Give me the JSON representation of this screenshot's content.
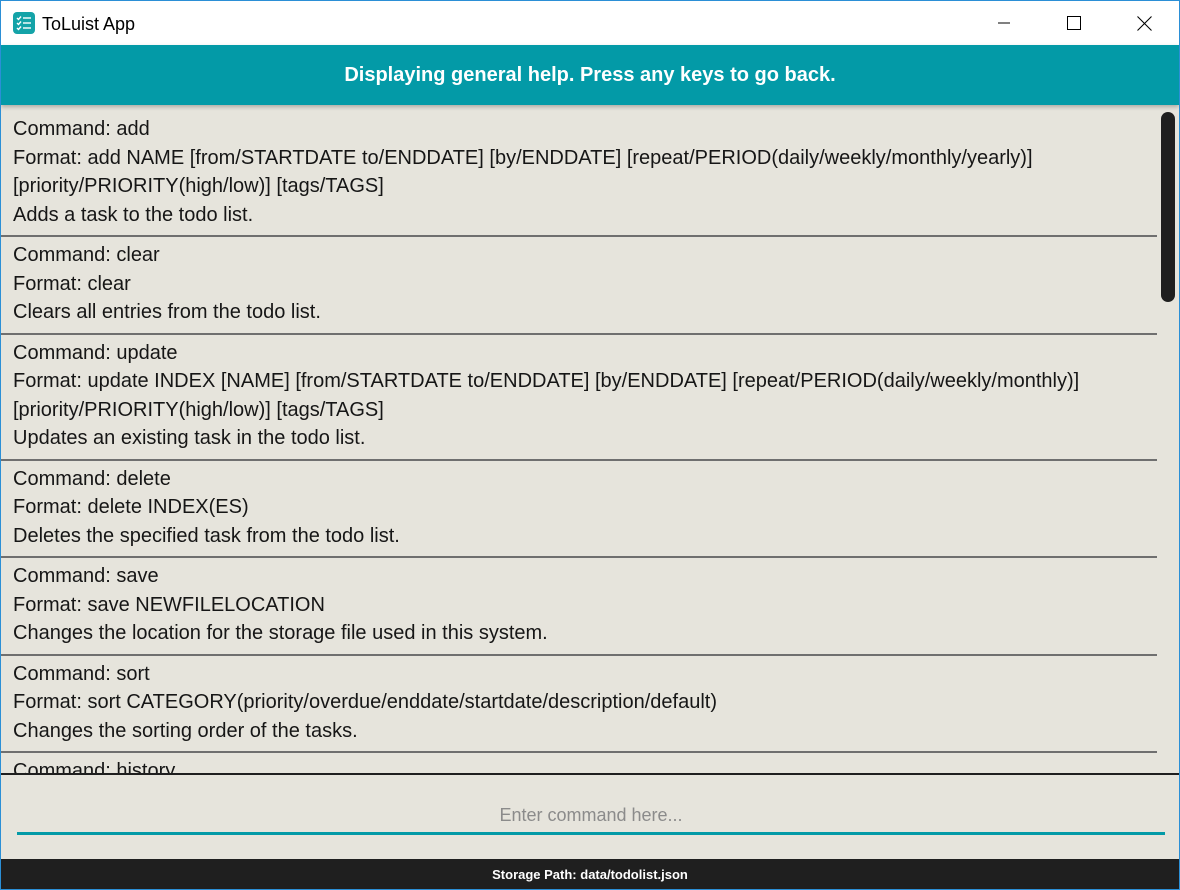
{
  "window": {
    "title": "ToLuist App",
    "app_icon": "checklist-icon",
    "controls": [
      "minimize-icon",
      "maximize-icon",
      "close-icon"
    ]
  },
  "banner": {
    "text": "Displaying general help. Press any keys to go back."
  },
  "commands": [
    {
      "command": "Command: add",
      "format": "Format: add NAME [from/STARTDATE to/ENDDATE] [by/ENDDATE] [repeat/PERIOD(daily/weekly/monthly/yearly)] [priority/PRIORITY(high/low)] [tags/TAGS]",
      "description": "Adds a task to the todo list."
    },
    {
      "command": "Command: clear",
      "format": "Format: clear",
      "description": "Clears all entries from the todo list."
    },
    {
      "command": "Command: update",
      "format": "Format: update INDEX [NAME] [from/STARTDATE to/ENDDATE] [by/ENDDATE] [repeat/PERIOD(daily/weekly/monthly)] [priority/PRIORITY(high/low)] [tags/TAGS]",
      "description": "Updates an existing task in the todo list."
    },
    {
      "command": "Command: delete",
      "format": "Format: delete INDEX(ES)",
      "description": "Deletes the specified task from the todo list."
    },
    {
      "command": "Command: save",
      "format": "Format: save NEWFILELOCATION",
      "description": "Changes the location for the storage file used in this system."
    },
    {
      "command": "Command: sort",
      "format": "Format: sort CATEGORY(priority/overdue/enddate/startdate/description/default)",
      "description": "Changes the sorting order of the tasks."
    },
    {
      "command": "Command: history",
      "format": "",
      "description": ""
    }
  ],
  "input": {
    "placeholder": "Enter command here...",
    "value": ""
  },
  "status": {
    "storage_path": "Storage Path: data/todolist.json"
  },
  "colors": {
    "accent": "#039aa7",
    "background": "#e6e4dc",
    "statusbar": "#1f1f1f"
  }
}
